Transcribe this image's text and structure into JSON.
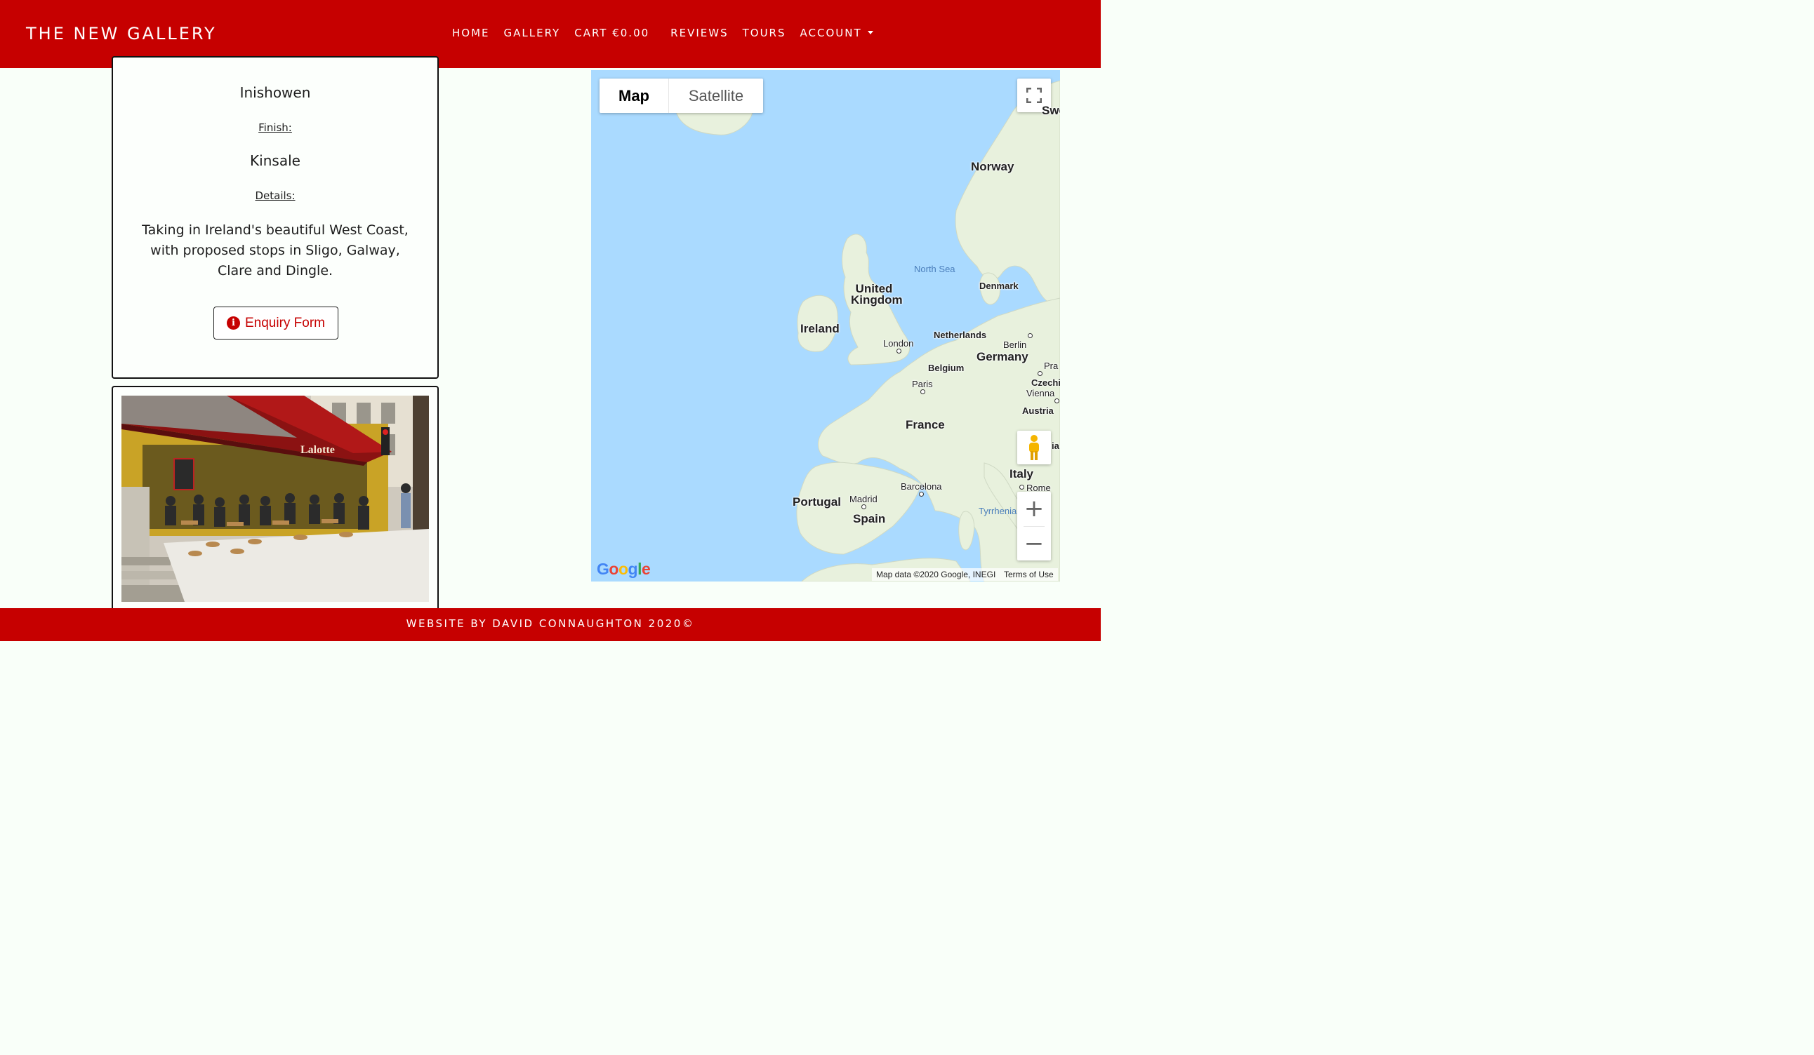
{
  "colors": {
    "brand": "#c60000",
    "page_bg": "#f9fff9",
    "map_water": "#aadaff",
    "map_land": "#e8f1dd"
  },
  "navbar": {
    "brand": "THE NEW GALLERY",
    "links": [
      "HOME",
      "GALLERY",
      "CART €0.00",
      "REVIEWS",
      "TOURS",
      "ACCOUNT"
    ]
  },
  "tour": {
    "start_place": "Inishowen",
    "finish_label": "Finish:",
    "finish_place": "Kinsale",
    "details_label": "Details:",
    "details": "Taking in Ireland's beautiful West Coast, with proposed stops in Sligo, Galway, Clare and Dingle.",
    "enquiry_button": "Enquiry Form",
    "enquiry_icon": "info-circle-icon"
  },
  "image_card": {
    "signage": "Lalotte"
  },
  "map": {
    "type_map": "Map",
    "type_satellite": "Satellite",
    "zoom_in": "+",
    "zoom_out": "−",
    "google_logo": "Google",
    "attribution": "Map data ©2020 Google, INEGI",
    "terms": "Terms of Use",
    "labels": {
      "norway": "Norway",
      "north_sea": "North Sea",
      "denmark": "Denmark",
      "uk": "United Kingdom",
      "ireland": "Ireland",
      "london": "London",
      "netherlands": "Netherlands",
      "berlin": "Berlin",
      "germany": "Germany",
      "belgium": "Belgium",
      "paris": "Paris",
      "prague": "Pra",
      "czechia": "Czechi",
      "vienna": "Vienna",
      "austria": "Austria",
      "france": "France",
      "italy": "Italy",
      "rome": "Rome",
      "barcelona": "Barcelona",
      "portugal": "Portugal",
      "madrid": "Madrid",
      "spain": "Spain",
      "tyrrhenian": "Tyrrhenia",
      "sweden": "Swe",
      "ia": "ia"
    }
  },
  "footer": {
    "text": "WEBSITE BY DAVID CONNAUGHTON 2020©"
  }
}
